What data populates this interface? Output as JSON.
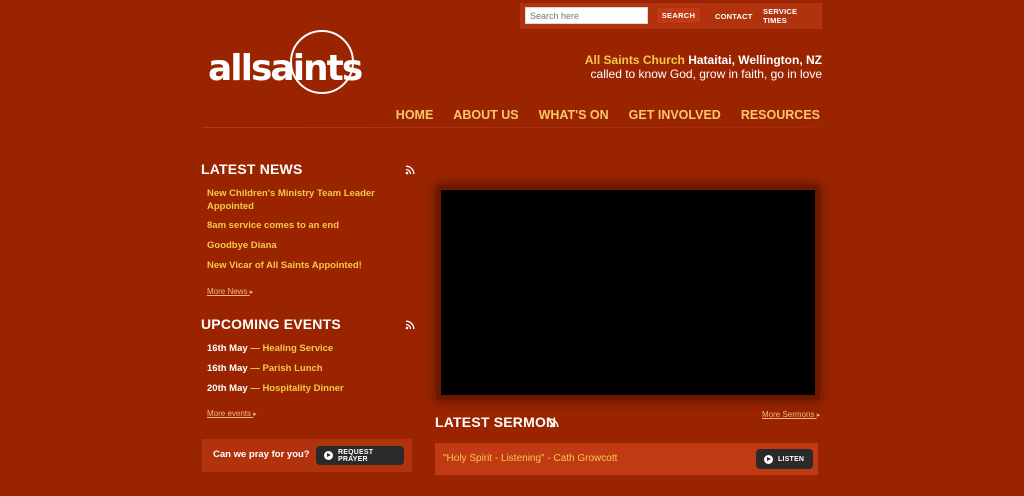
{
  "header": {
    "search": {
      "placeholder": "Search here",
      "button_label": "SEARCH"
    },
    "top_links": [
      "CONTACT",
      "SERVICE TIMES"
    ],
    "logo_text": "allsaints",
    "church_name": "All Saints Church",
    "location": "Hataitai, Wellington, NZ",
    "tagline": "called to know God, grow in faith, go in love"
  },
  "nav": {
    "items": [
      "HOME",
      "ABOUT US",
      "WHAT'S ON",
      "GET INVOLVED",
      "RESOURCES"
    ]
  },
  "latest_news": {
    "title": "LATEST NEWS",
    "items": [
      "New Children's Ministry Team Leader Appointed",
      "8am service comes to an end",
      "Goodbye Diana",
      "New Vicar of All Saints Appointed!"
    ],
    "more_label": "More News"
  },
  "upcoming_events": {
    "title": "UPCOMING EVENTS",
    "items": [
      {
        "date": "16th May",
        "dash": "—",
        "title": "Healing Service"
      },
      {
        "date": "16th May",
        "dash": "—",
        "title": "Parish Lunch"
      },
      {
        "date": "20th May",
        "dash": "—",
        "title": "Hospitality Dinner"
      }
    ],
    "more_label": "More events"
  },
  "prayer": {
    "text": "Can we pray for you?",
    "button_label": "REQUEST PRAYER"
  },
  "sermon": {
    "title": "LATEST SERMON",
    "more_label": "More Sermons",
    "current": "\"Holy Spirit - Listening\" - Cath Growcott",
    "listen_label": "LISTEN"
  },
  "colors": {
    "background": "#9a2400",
    "panel": "#b1330d",
    "accent_yellow": "#f5c84a",
    "nav_orange": "#f9c86a",
    "button_dark": "#2a2a2a"
  },
  "icons": {
    "rss": "rss-icon",
    "chevron": "chevron-right-icon",
    "play": "play-circle-icon"
  }
}
